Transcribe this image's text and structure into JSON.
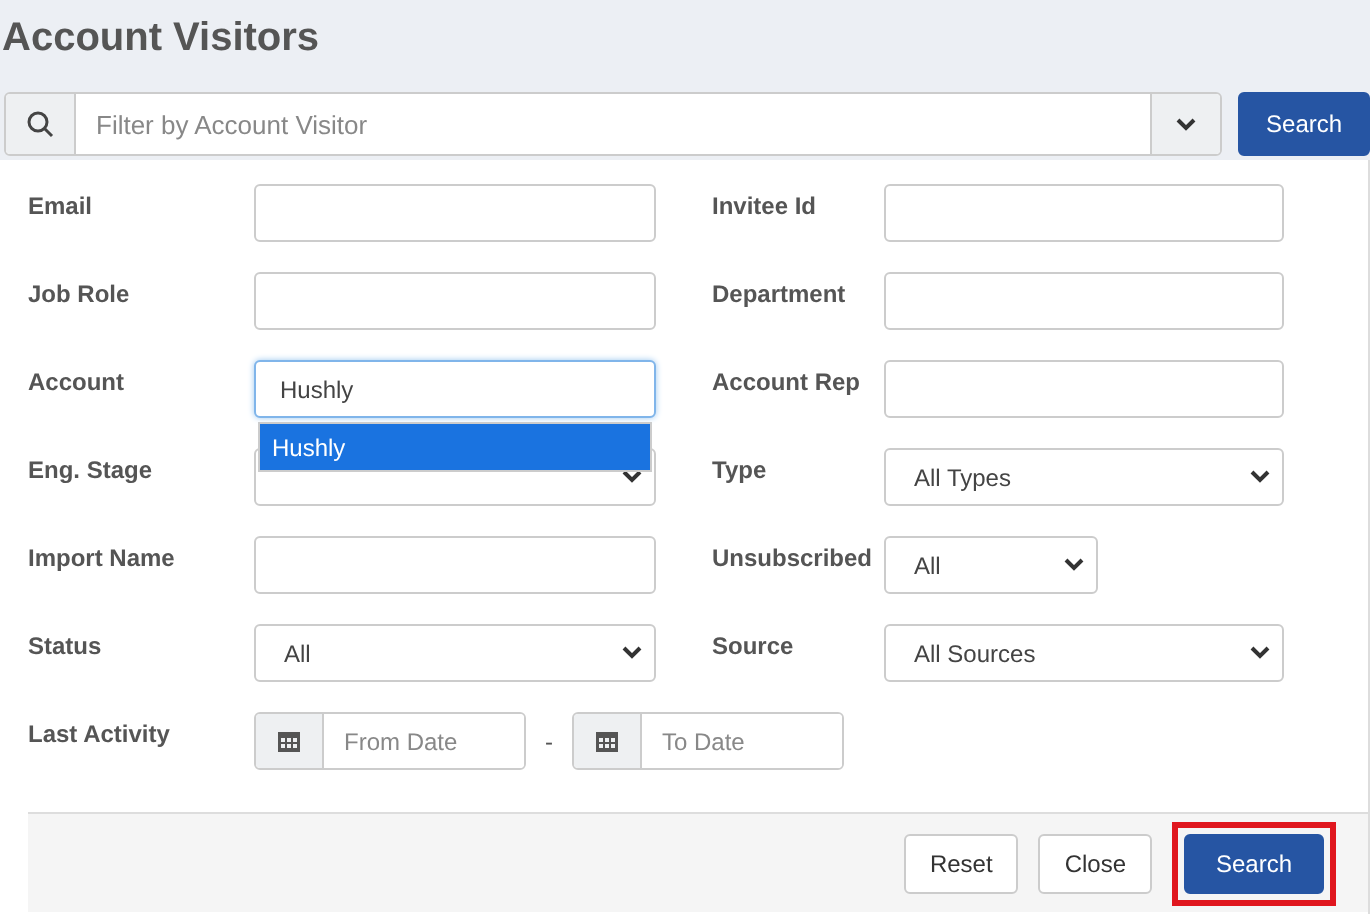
{
  "title": "Account Visitors",
  "filter": {
    "placeholder": "Filter by Account Visitor",
    "button": "Search"
  },
  "fields": [
    {
      "kind": "text",
      "label": "Email"
    },
    {
      "kind": "text",
      "label": "Invitee Id"
    },
    {
      "kind": "text",
      "label": "Job Role"
    },
    {
      "kind": "text",
      "label": "Department"
    },
    {
      "kind": "autocomplete",
      "label": "Account",
      "value": "Hushly",
      "suggestions": [
        {
          "label": "Hushly",
          "selected": true
        }
      ]
    },
    {
      "kind": "text",
      "label": "Account Rep"
    },
    {
      "kind": "select",
      "label": "Eng. Stage"
    },
    {
      "kind": "select",
      "label": "Type",
      "value": "All Types"
    },
    {
      "kind": "text",
      "label": "Import Name"
    },
    {
      "kind": "select-narrow",
      "label": "Unsubscribed",
      "value": "All"
    },
    {
      "kind": "select",
      "label": "Status",
      "value": "All"
    },
    {
      "kind": "select",
      "label": "Source",
      "value": "All Sources"
    },
    {
      "kind": "date-range",
      "label": "Last Activity",
      "from_placeholder": "From Date",
      "separator": "-",
      "to_placeholder": "To Date"
    }
  ],
  "footer_buttons": [
    {
      "label": "Reset",
      "kind": "default",
      "highlighted": false
    },
    {
      "label": "Close",
      "kind": "default",
      "highlighted": false
    },
    {
      "label": "Search",
      "kind": "primary",
      "highlighted": true
    }
  ]
}
